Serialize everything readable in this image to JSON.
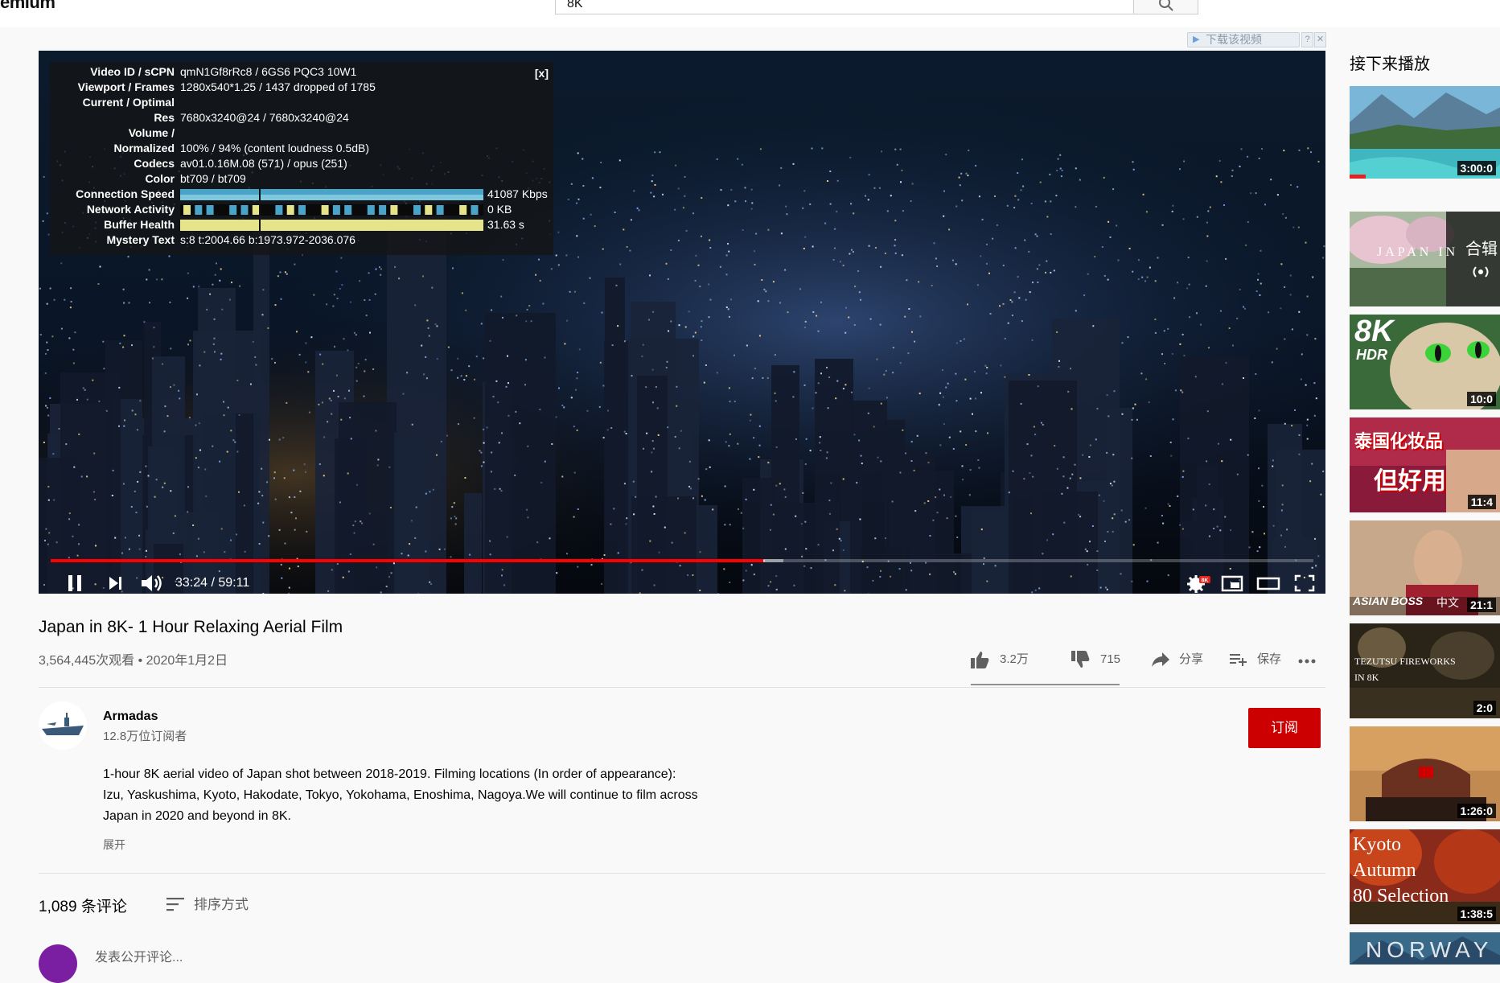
{
  "header": {
    "brand_fragment": "emium",
    "search_value": "8K"
  },
  "download_helper": {
    "label": "下载该视频",
    "help": "?",
    "close": "✕"
  },
  "stats": {
    "close_label": "[x]",
    "rows": [
      {
        "label": "Video ID / sCPN",
        "value": "qmN1Gf8rRc8 / 6GS6 PQC3 10W1"
      },
      {
        "label": "Viewport / Frames",
        "value": "1280x540*1.25 / 1437 dropped of 1785"
      },
      {
        "label": "Current / Optimal",
        "value": ""
      },
      {
        "label": "Res",
        "value": "7680x3240@24 / 7680x3240@24"
      },
      {
        "label": "Volume /",
        "value": ""
      },
      {
        "label": "Normalized",
        "value": "100% / 94% (content loudness 0.5dB)"
      },
      {
        "label": "Codecs",
        "value": "av01.0.16M.08 (571) / opus (251)"
      },
      {
        "label": "Color",
        "value": "bt709 / bt709"
      },
      {
        "label": "Connection Speed",
        "value": "41087 Kbps"
      },
      {
        "label": "Network Activity",
        "value": "0 KB"
      },
      {
        "label": "Buffer Health",
        "value": "31.63 s"
      },
      {
        "label": "Mystery Text",
        "value": "s:8 t:2004.66 b:1973.972-2036.076"
      }
    ]
  },
  "player": {
    "time": "33:24 / 59:11",
    "progress_played": 0.5645,
    "progress_buffered": 0.58,
    "quality_badge": "8K"
  },
  "video": {
    "title": "Japan in 8K- 1 Hour Relaxing Aerial Film",
    "meta": "3,564,445次观看 • 2020年1月2日",
    "likes": "3.2万",
    "dislikes": "715",
    "share": "分享",
    "save": "保存"
  },
  "channel": {
    "name": "Armadas",
    "subscribers": "12.8万位订阅者",
    "subscribe_label": "订阅",
    "description": "1-hour 8K aerial video of Japan shot between 2018-2019. Filming locations (In order of appearance): Izu, Yaskushima, Kyoto, Hakodate, Tokyo, Yokohama, Enoshima, Nagoya.We will continue to film across Japan in 2020 and beyond in 8K.",
    "expand": "展开"
  },
  "comments": {
    "count": "1,089 条评论",
    "sort_label": "排序方式",
    "prompt": "发表公开评论..."
  },
  "sidebar": {
    "heading": "接下来播放",
    "items": [
      {
        "duration": "3:00:0",
        "overlay": ""
      },
      {
        "duration": "",
        "overlay": "JAPAN IN",
        "badge": "合辑"
      },
      {
        "duration": "10:0",
        "overlay": "8K",
        "overlay2": "HDR"
      },
      {
        "duration": "11:4",
        "overlay": "泰国化妆品",
        "overlay2": "但好用"
      },
      {
        "duration": "21:1",
        "overlay": "ASIAN BOSS",
        "overlay2": "中文"
      },
      {
        "duration": "2:0",
        "overlay": "TEZUTSU FIREWORKS",
        "overlay2": "IN 8K"
      },
      {
        "duration": "1:26:0",
        "overlay": ""
      },
      {
        "duration": "1:38:5",
        "overlay": "Kyoto",
        "overlay2": "Autumn",
        "overlay3": "80 Selection"
      },
      {
        "duration": "",
        "overlay": "NORWAY"
      }
    ]
  }
}
